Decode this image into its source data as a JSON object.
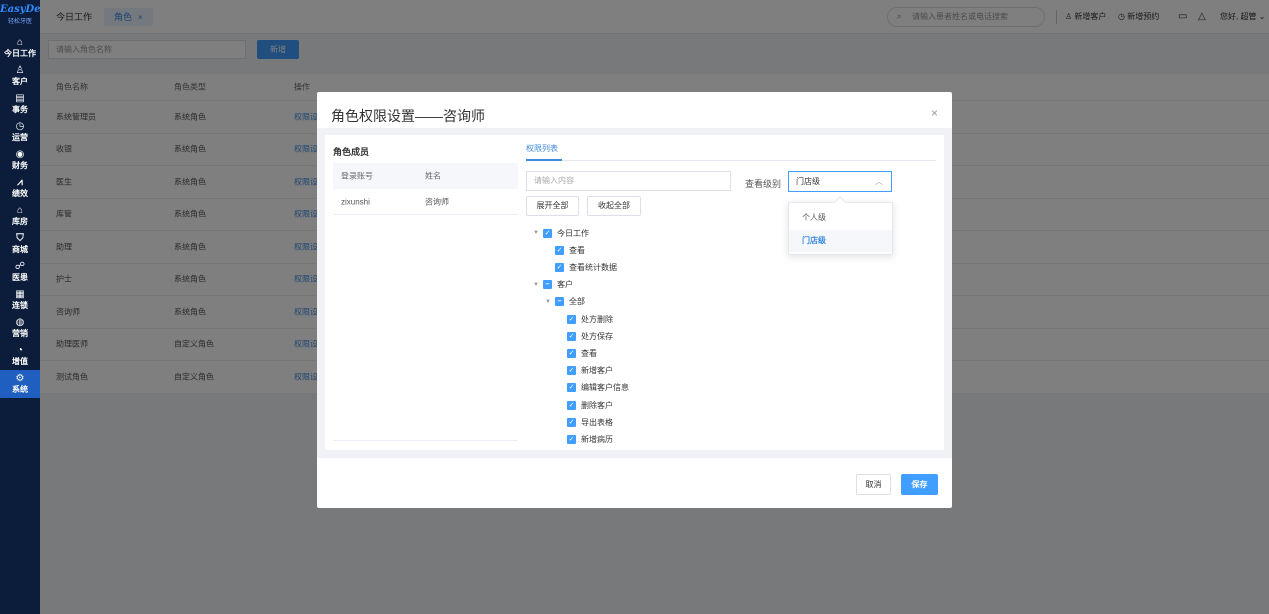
{
  "sidebar": {
    "brand": "EasyDent",
    "brand_sub": "轻松牙医",
    "items": [
      {
        "label": "今日工作",
        "icon": "⌂",
        "icon_name": "home-icon"
      },
      {
        "label": "客户",
        "icon": "♙",
        "icon_name": "customer-icon"
      },
      {
        "label": "事务",
        "icon": "▤",
        "icon_name": "task-icon"
      },
      {
        "label": "运营",
        "icon": "◷",
        "icon_name": "operation-icon"
      },
      {
        "label": "财务",
        "icon": "◉",
        "icon_name": "finance-icon"
      },
      {
        "label": "绩效",
        "icon": "⩘",
        "icon_name": "performance-icon"
      },
      {
        "label": "库房",
        "icon": "⌂",
        "icon_name": "warehouse-icon"
      },
      {
        "label": "商城",
        "icon": "⛉",
        "icon_name": "mall-icon"
      },
      {
        "label": "医患",
        "icon": "☍",
        "icon_name": "doctor-patient-icon"
      },
      {
        "label": "连锁",
        "icon": "▦",
        "icon_name": "chain-icon"
      },
      {
        "label": "营销",
        "icon": "◍",
        "icon_name": "marketing-icon"
      },
      {
        "label": "增值",
        "icon": "◔",
        "icon_name": "value-added-icon"
      },
      {
        "label": "系统",
        "icon": "⚙",
        "icon_name": "system-icon"
      }
    ]
  },
  "topbar": {
    "tab_home": "今日工作",
    "tab_role": "角色",
    "tab_close": "×",
    "search_placeholder": "请输入患者姓名或电话搜索",
    "new_customer": "新增客户",
    "new_appointment": "新增预约",
    "greeting": "您好, 超管"
  },
  "page": {
    "role_input_placeholder": "请输入角色名称",
    "add_button": "新增",
    "table_headers": [
      "角色名称",
      "角色类型",
      "操作"
    ],
    "rows": [
      [
        "系统管理员",
        "系统角色",
        "权限设"
      ],
      [
        "收银",
        "系统角色",
        "权限设"
      ],
      [
        "医生",
        "系统角色",
        "权限设"
      ],
      [
        "库管",
        "系统角色",
        "权限设"
      ],
      [
        "助理",
        "系统角色",
        "权限设"
      ],
      [
        "护士",
        "系统角色",
        "权限设"
      ],
      [
        "咨询师",
        "系统角色",
        "权限设"
      ],
      [
        "助理医师",
        "自定义角色",
        "权限设"
      ],
      [
        "测试角色",
        "自定义角色",
        "权限设"
      ]
    ]
  },
  "modal": {
    "title": "角色权限设置——咨询师",
    "close": "×",
    "members_title": "角色成员",
    "members_headers": [
      "登录账号",
      "姓名"
    ],
    "members": [
      [
        "zixunshi",
        "咨询师"
      ]
    ],
    "perm_tab": "权限列表",
    "perm_search_placeholder": "请输入内容",
    "level_label": "查看级别",
    "level_value": "门店级",
    "expand_all": "展开全部",
    "collapse_all": "收起全部",
    "tree": [
      {
        "label": "今日工作",
        "level": 0,
        "arrow": true,
        "check": "checked"
      },
      {
        "label": "查看",
        "level": 1,
        "arrow": false,
        "check": "checked"
      },
      {
        "label": "查看统计数据",
        "level": 1,
        "arrow": false,
        "check": "checked"
      },
      {
        "label": "客户",
        "level": 0,
        "arrow": true,
        "check": "partial"
      },
      {
        "label": "全部",
        "level": 1,
        "arrow": true,
        "check": "partial"
      },
      {
        "label": "处方删除",
        "level": 2,
        "arrow": false,
        "check": "checked"
      },
      {
        "label": "处方保存",
        "level": 2,
        "arrow": false,
        "check": "checked"
      },
      {
        "label": "查看",
        "level": 2,
        "arrow": false,
        "check": "checked"
      },
      {
        "label": "新增客户",
        "level": 2,
        "arrow": false,
        "check": "checked"
      },
      {
        "label": "编辑客户信息",
        "level": 2,
        "arrow": false,
        "check": "checked"
      },
      {
        "label": "删除客户",
        "level": 2,
        "arrow": false,
        "check": "checked"
      },
      {
        "label": "导出表格",
        "level": 2,
        "arrow": false,
        "check": "checked"
      },
      {
        "label": "新增病历",
        "level": 2,
        "arrow": false,
        "check": "checked"
      }
    ],
    "level_options": [
      "个人级",
      "门店级"
    ],
    "level_selected_index": 1,
    "cancel": "取消",
    "save": "保存"
  }
}
